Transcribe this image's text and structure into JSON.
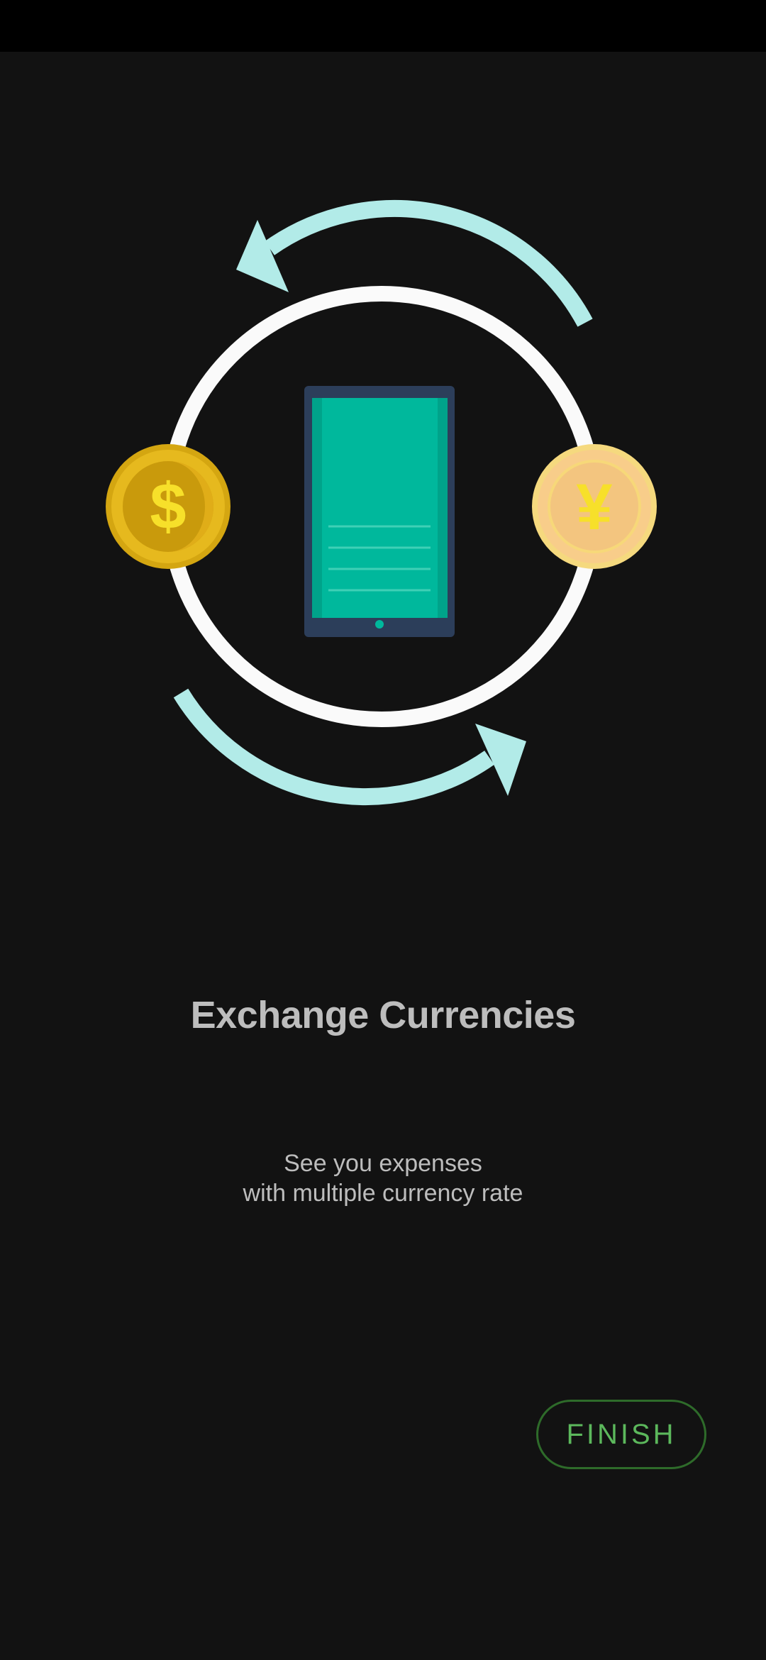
{
  "onboarding": {
    "title": "Exchange Currencies",
    "subtitle_line1": "See you expenses",
    "subtitle_line2": "with multiple currency rate",
    "finish_label": "FINISH"
  },
  "illustration": {
    "left_coin_symbol": "$",
    "right_coin_symbol": "¥"
  },
  "colors": {
    "background": "#121212",
    "arrow": "#b2ebe8",
    "phone_screen": "#00b89c",
    "phone_body": "#2c3e5a",
    "accent_button": "#5cb85c"
  }
}
